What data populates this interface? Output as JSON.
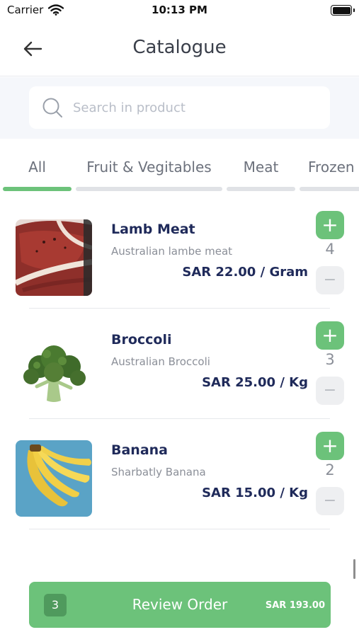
{
  "status_bar": {
    "carrier": "Carrier",
    "time": "10:13 PM"
  },
  "header": {
    "title": "Catalogue",
    "back_icon": "arrow-left-icon"
  },
  "search": {
    "placeholder": "Search in product",
    "value": "",
    "icon": "search-icon"
  },
  "tabs": [
    {
      "label": "All",
      "active": true
    },
    {
      "label": "Fruit & Vegitables",
      "active": false
    },
    {
      "label": "Meat",
      "active": false
    },
    {
      "label": "Frozen",
      "active": false
    }
  ],
  "products": [
    {
      "name": "Lamb Meat",
      "description": "Australian lambe meat",
      "price": "SAR 22.00 / Gram",
      "quantity": "4",
      "image": "lamb-meat-image"
    },
    {
      "name": "Broccoli",
      "description": "Australian Broccoli",
      "price": "SAR 25.00 / Kg",
      "quantity": "3",
      "image": "broccoli-image"
    },
    {
      "name": "Banana",
      "description": "Sharbatly Banana",
      "price": "SAR 15.00 / Kg",
      "quantity": "2",
      "image": "banana-image"
    }
  ],
  "controls": {
    "plus": "+",
    "minus": "−"
  },
  "review": {
    "count": "3",
    "label": "Review Order",
    "total": "SAR 193.00"
  },
  "colors": {
    "accent": "#6cc27a",
    "accent_dark": "#4f9a5d",
    "text_dark": "#1f2a5a",
    "muted": "#8b8f98"
  }
}
